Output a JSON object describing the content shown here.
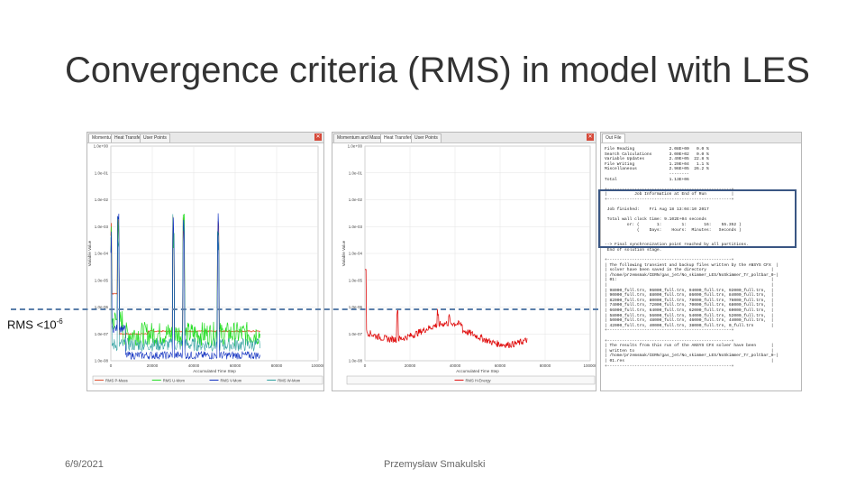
{
  "slide": {
    "title": "Convergence criteria (RMS) in model with LES",
    "date": "6/9/2021",
    "author": "Przemysław Smakulski",
    "rms_label_prefix": "RMS <10",
    "rms_label_exp": "-6"
  },
  "panel_left": {
    "tabs": [
      "Momentum and Mass",
      "Heat Transfer",
      "User Points"
    ],
    "ylabel": "Variable Value",
    "xlabel": "Accumulated Time Step",
    "yticks": [
      "1.0e+00",
      "1.0e-01",
      "1.0e-02",
      "1.0e-03",
      "1.0e-04",
      "1.0e-05",
      "1.0e-06",
      "1.0e-07",
      "1.0e-08"
    ],
    "xticks": [
      "0",
      "20000",
      "40000",
      "60000",
      "80000",
      "100000"
    ],
    "legend": [
      "RMS P-Mass",
      "RMS U-Mom",
      "RMS V-Mom",
      "RMS W-Mom"
    ]
  },
  "panel_mid": {
    "tabs": [
      "Momentum and Mass",
      "Heat Transfer",
      "User Points"
    ],
    "ylabel": "Variable Value",
    "xlabel": "Accumulated Time Step",
    "yticks": [
      "1.0e+00",
      "1.0e-01",
      "1.0e-02",
      "1.0e-03",
      "1.0e-04",
      "1.0e-05",
      "1.0e-06",
      "1.0e-07",
      "1.0e-08"
    ],
    "xticks": [
      "0",
      "20000",
      "40000",
      "60000",
      "80000",
      "100000"
    ],
    "legend": [
      "RMS H-Energy"
    ]
  },
  "outfile": {
    "tab": "Out File",
    "text": "File Reading              2.08E+00   0.0 %\nSearch Calculations       3.00E+02   0.0 %\nVariable Updates          2.49E+05  22.8 %\nFile Writing              1.29E+04   1.1 %\nMiscellaneous             2.96E+05  26.2 %\n                          --------\nTotal                     1.13E+06\n\n+--------------------------------------------------+\n|           Job Information at End of Run          |\n+--------------------------------------------------+\n\n Job finished:    Fri Aug 18 13:04:10 2017\n\n Total wall clock time: 9.102E+04 seconds\n         or: (       1:        1:       16:    55.352 )\n             (    Days:    Hours:  Minutes:   Seconds )\n\n\n--> Final synchronization point reached by all partitions.\n End of solution stage.\n\n+--------------------------------------------------+\n| The following transient and backup files written by the ANSYS CFX  |\n| solver have been saved in the directory                          |\n| /home/przemsmak/CERN/gas_jet/No_skimmer_LES/NoSkimmer_Tr_poltbar_0-|\n| 01:                                                              |\n|                                                                  |\n| 98000_full.trn, 96000_full.trn, 94000_full.trn, 92000_full.trn,  |\n| 90000_full.trn, 88000_full.trn, 86000_full.trn, 84000_full.trn,  |\n| 82000_full.trn, 80000_full.trn, 78000_full.trn, 76000_full.trn,  |\n| 74000_full.trn, 72000_full.trn, 70000_full.trn, 68000_full.trn,  |\n| 66000_full.trn, 64000_full.trn, 62000_full.trn, 60000_full.trn,  |\n| 58000_full.trn, 56000_full.trn, 54000_full.trn, 52000_full.trn,  |\n| 50000_full.trn, 48000_full.trn, 46000_full.trn, 44000_full.trn,  |\n| 42000_full.trn, 40000_full.trn, 38000_full.trn, 0_full.trn       |\n+--------------------------------------------------+\n\n+--------------------------------------------------+\n| The results from this run of the ANSYS CFX solver have been      |\n| written to                                                       |\n| /home/przemsmak/CERN/gas_jet/No_skimmer_LES/NoSkimmer_Tr_poltbar_0-|\n| 01.res                                                           |\n+--------------------------------------------------+"
  },
  "colors": {
    "p_mass": "#e05030",
    "u_mom": "#22dd22",
    "v_mom": "#1030c0",
    "w_mom": "#30a0a0",
    "h_energy": "#e01010",
    "grid": "#e2e2e2",
    "dash": "#5b7faa",
    "highlight": "#3a5683"
  }
}
